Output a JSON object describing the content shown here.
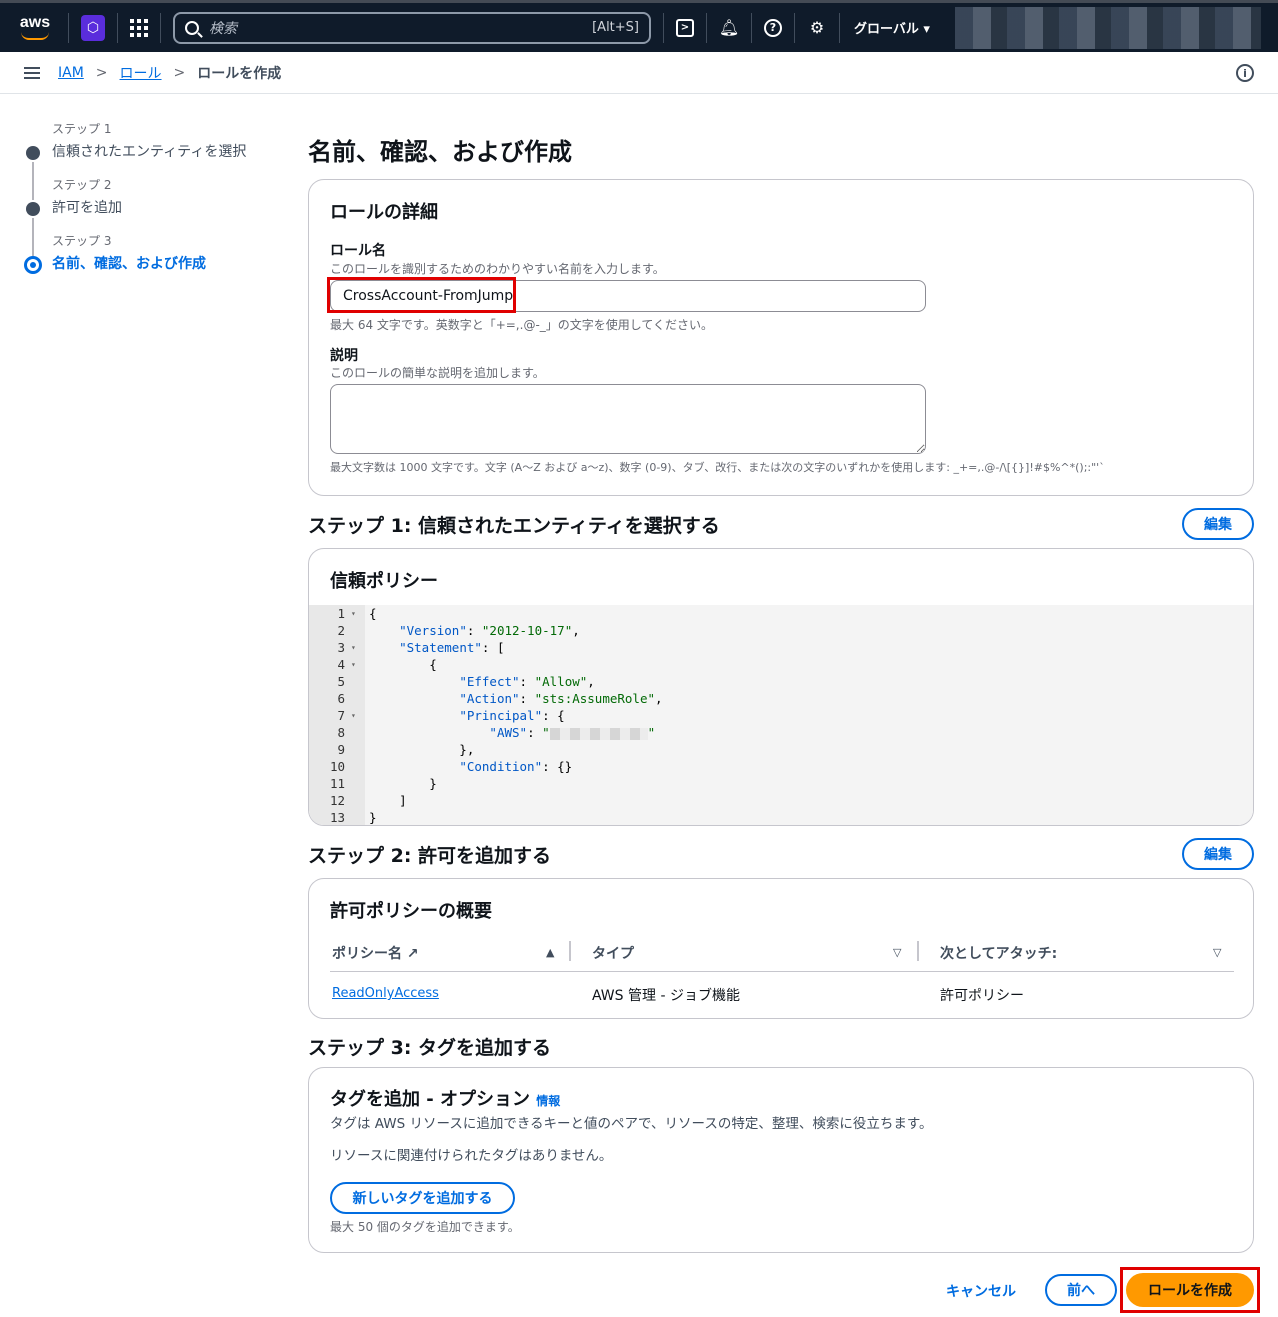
{
  "topnav": {
    "logo": "aws",
    "search_placeholder": "検索",
    "search_shortcut": "[Alt+S]",
    "region": "グローバル ▾"
  },
  "breadcrumb": {
    "items": [
      "IAM",
      "ロール"
    ],
    "current": "ロールを作成"
  },
  "steps": [
    {
      "label": "ステップ 1",
      "title": "信頼されたエンティティを選択"
    },
    {
      "label": "ステップ 2",
      "title": "許可を追加"
    },
    {
      "label": "ステップ 3",
      "title": "名前、確認、および作成"
    }
  ],
  "page_title": "名前、確認、および作成",
  "role_details": {
    "heading": "ロールの詳細",
    "name_label": "ロール名",
    "name_desc": "このロールを識別するためのわかりやすい名前を入力します。",
    "name_value": "CrossAccount-FromJump",
    "name_hint": "最大 64 文字です。英数字と「+=,.@-_」の文字を使用してください。",
    "desc_label": "説明",
    "desc_desc": "このロールの簡単な説明を追加します。",
    "desc_value": "",
    "desc_hint": "最大文字数は 1000 文字です。文字 (A〜Z および a〜z)、数字 (0-9)、タブ、改行、または次の文字のいずれかを使用します: _+=,.@-/\\[{}]!#$%^*();:\"'`"
  },
  "step1": {
    "title": "ステップ 1: 信頼されたエンティティを選択する",
    "edit": "編集",
    "card_heading": "信頼ポリシー",
    "code_lines": [
      {
        "n": "1",
        "fold": true,
        "parts": [
          {
            "t": "{",
            "c": ""
          }
        ]
      },
      {
        "n": "2",
        "fold": false,
        "parts": [
          {
            "t": "    ",
            "c": ""
          },
          {
            "t": "\"Version\"",
            "c": "k"
          },
          {
            "t": ": ",
            "c": ""
          },
          {
            "t": "\"2012-10-17\"",
            "c": "s"
          },
          {
            "t": ",",
            "c": ""
          }
        ]
      },
      {
        "n": "3",
        "fold": true,
        "parts": [
          {
            "t": "    ",
            "c": ""
          },
          {
            "t": "\"Statement\"",
            "c": "k"
          },
          {
            "t": ": [",
            "c": ""
          }
        ]
      },
      {
        "n": "4",
        "fold": true,
        "parts": [
          {
            "t": "        {",
            "c": ""
          }
        ]
      },
      {
        "n": "5",
        "fold": false,
        "parts": [
          {
            "t": "            ",
            "c": ""
          },
          {
            "t": "\"Effect\"",
            "c": "k"
          },
          {
            "t": ": ",
            "c": ""
          },
          {
            "t": "\"Allow\"",
            "c": "s"
          },
          {
            "t": ",",
            "c": ""
          }
        ]
      },
      {
        "n": "6",
        "fold": false,
        "parts": [
          {
            "t": "            ",
            "c": ""
          },
          {
            "t": "\"Action\"",
            "c": "k"
          },
          {
            "t": ": ",
            "c": ""
          },
          {
            "t": "\"sts:AssumeRole\"",
            "c": "s"
          },
          {
            "t": ",",
            "c": ""
          }
        ]
      },
      {
        "n": "7",
        "fold": true,
        "parts": [
          {
            "t": "            ",
            "c": ""
          },
          {
            "t": "\"Principal\"",
            "c": "k"
          },
          {
            "t": ": {",
            "c": ""
          }
        ]
      },
      {
        "n": "8",
        "fold": false,
        "parts": [
          {
            "t": "                ",
            "c": ""
          },
          {
            "t": "\"AWS\"",
            "c": "k"
          },
          {
            "t": ": ",
            "c": ""
          },
          {
            "t": "\"",
            "c": "s"
          },
          {
            "t": "BLUR",
            "c": "blur"
          },
          {
            "t": "\"",
            "c": "s"
          }
        ]
      },
      {
        "n": "9",
        "fold": false,
        "parts": [
          {
            "t": "            },",
            "c": ""
          }
        ]
      },
      {
        "n": "10",
        "fold": false,
        "parts": [
          {
            "t": "            ",
            "c": ""
          },
          {
            "t": "\"Condition\"",
            "c": "k"
          },
          {
            "t": ": {}",
            "c": ""
          }
        ]
      },
      {
        "n": "11",
        "fold": false,
        "parts": [
          {
            "t": "        }",
            "c": ""
          }
        ]
      },
      {
        "n": "12",
        "fold": false,
        "parts": [
          {
            "t": "    ]",
            "c": ""
          }
        ]
      },
      {
        "n": "13",
        "fold": false,
        "parts": [
          {
            "t": "}",
            "c": ""
          }
        ]
      }
    ]
  },
  "step2": {
    "title": "ステップ 2: 許可を追加する",
    "edit": "編集",
    "card_heading": "許可ポリシーの概要",
    "columns": [
      "ポリシー名",
      "タイプ",
      "次としてアタッチ:"
    ],
    "rows": [
      {
        "policy": "ReadOnlyAccess",
        "type": "AWS 管理 - ジョブ機能",
        "attached": "許可ポリシー"
      }
    ]
  },
  "step3": {
    "title": "ステップ 3: タグを追加する",
    "card_heading": "タグを追加 - オプション",
    "info": "情報",
    "desc": "タグは AWS リソースに追加できるキーと値のペアで、リソースの特定、整理、検索に役立ちます。",
    "empty": "リソースに関連付けられたタグはありません。",
    "add_button": "新しいタグを追加する",
    "limit": "最大 50 個のタグを追加できます。"
  },
  "footer": {
    "cancel": "キャンセル",
    "previous": "前へ",
    "create": "ロールを作成"
  },
  "colors": {
    "primary": "#ff9900",
    "link": "#006ce0",
    "highlight": "#e00000",
    "nav": "#0f1b2a"
  }
}
